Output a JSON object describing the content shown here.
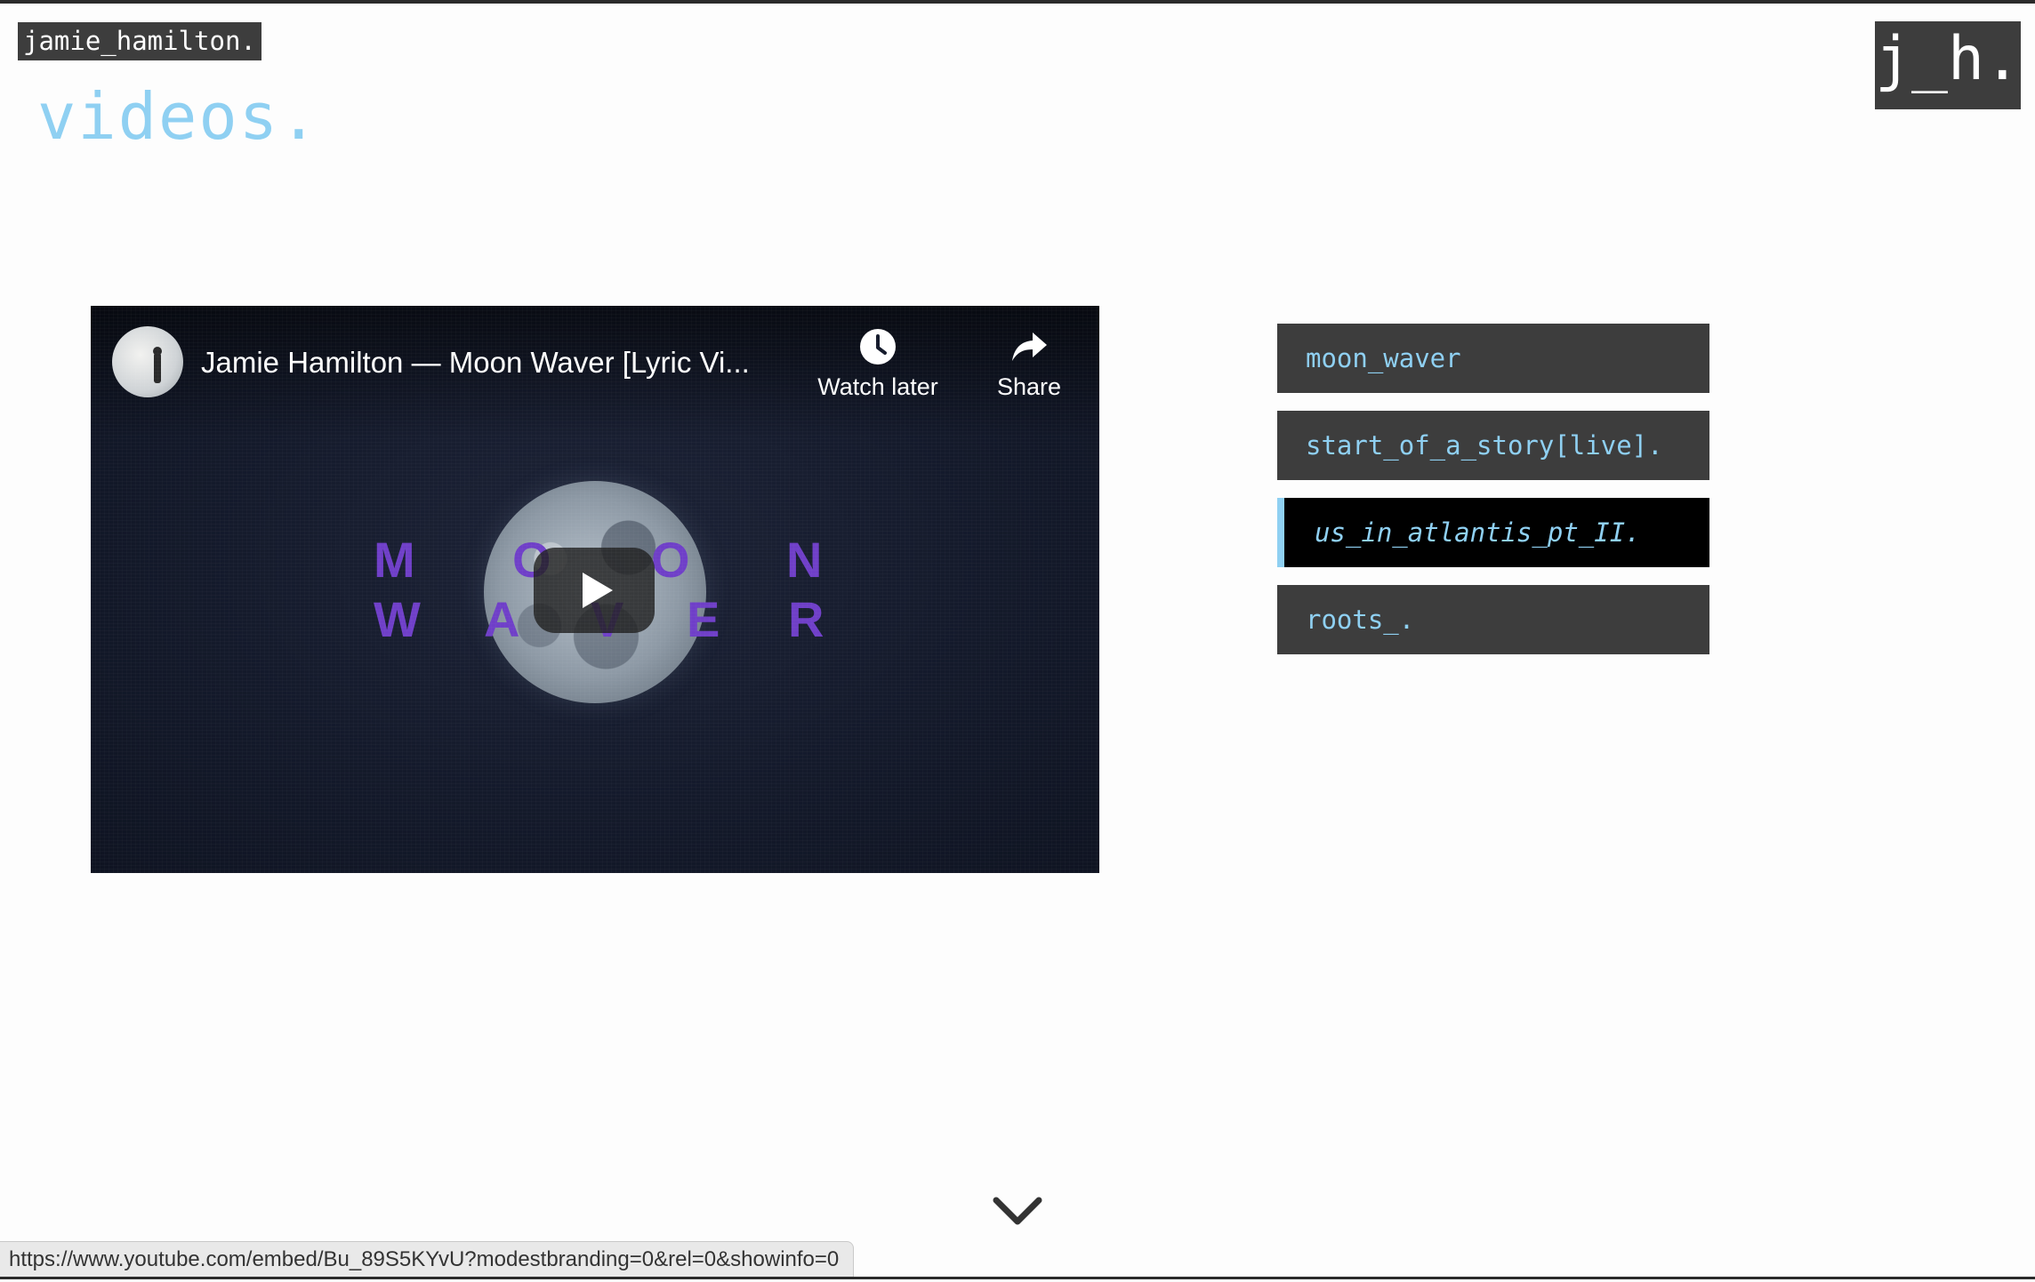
{
  "site": {
    "name": "jamie_hamilton.",
    "heading": "videos.",
    "logo": "j_h."
  },
  "player": {
    "title": "Jamie Hamilton — Moon Waver [Lyric Vi...",
    "watch_later_label": "Watch later",
    "share_label": "Share",
    "lyric_letters": [
      "M",
      "O",
      "O",
      "N",
      "W",
      "A",
      "V",
      "E",
      "R"
    ]
  },
  "video_list": {
    "items": [
      {
        "label": "moon_waver",
        "active": false
      },
      {
        "label": "start_of_a_story[live].",
        "active": false
      },
      {
        "label": "us_in_atlantis_pt_II.",
        "active": true
      },
      {
        "label": "roots_.",
        "active": false
      }
    ]
  },
  "status_bar": {
    "url": "https://www.youtube.com/embed/Bu_89S5KYvU?modestbranding=0&rel=0&showinfo=0"
  },
  "colors": {
    "accent": "#8fd0f2",
    "panel": "#3d3d3d",
    "lyric": "#6f3fc8"
  }
}
